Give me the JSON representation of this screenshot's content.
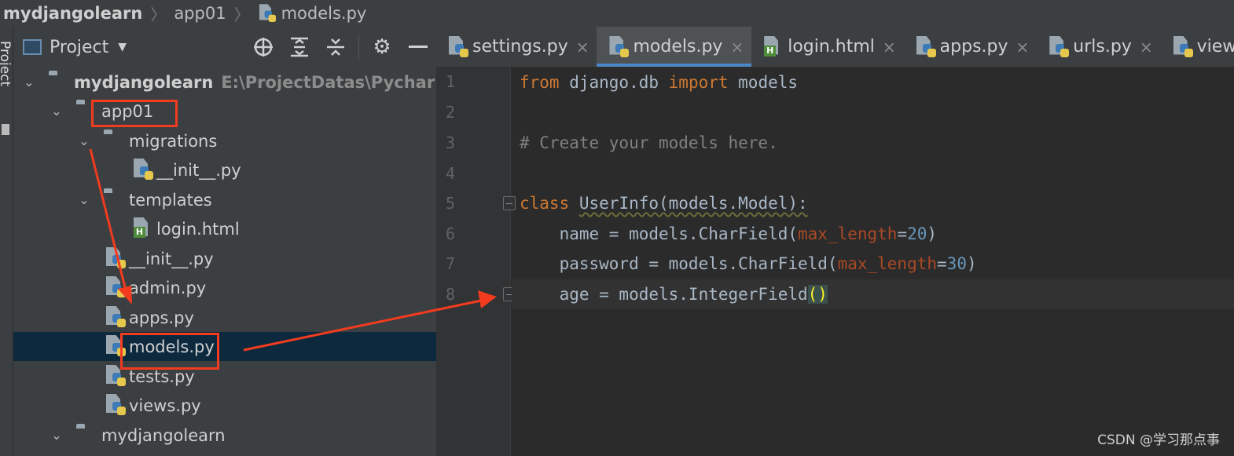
{
  "breadcrumb": {
    "project": "mydjangolearn",
    "folder": "app01",
    "file": "models.py"
  },
  "side_strip": {
    "label": "Project"
  },
  "project_panel": {
    "title": "Project",
    "icons": [
      "crosshair-icon",
      "expand-all-icon",
      "collapse-all-icon",
      "gear-icon",
      "minimize-icon"
    ],
    "root": {
      "name": "mydjangolearn",
      "path": "E:\\ProjectDatas\\PycharmPro"
    },
    "items": [
      {
        "label": "app01"
      },
      {
        "label": "migrations"
      },
      {
        "label": "__init__.py"
      },
      {
        "label": "templates"
      },
      {
        "label": "login.html"
      },
      {
        "label": "__init__.py"
      },
      {
        "label": "admin.py"
      },
      {
        "label": "apps.py"
      },
      {
        "label": "models.py"
      },
      {
        "label": "tests.py"
      },
      {
        "label": "views.py"
      },
      {
        "label": "mydjangolearn"
      }
    ],
    "selected": "models.py"
  },
  "tabs": [
    {
      "label": "settings.py",
      "close": "×"
    },
    {
      "label": "models.py",
      "close": "×",
      "active": true
    },
    {
      "label": "login.html",
      "close": "×"
    },
    {
      "label": "apps.py",
      "close": "×"
    },
    {
      "label": "urls.py",
      "close": "×"
    },
    {
      "label": "views.py",
      "close": ""
    }
  ],
  "editor": {
    "line_numbers": [
      "1",
      "2",
      "3",
      "4",
      "5",
      "6",
      "7",
      "8"
    ],
    "code": {
      "l1": {
        "kw1": "from",
        "t1": " django.db ",
        "kw2": "import",
        "t2": " models"
      },
      "l3": {
        "comment": "# Create your models here."
      },
      "l5": {
        "kw": "class",
        "t1": " ",
        "cls": "UserInfo(models.Model):"
      },
      "l6": {
        "t1": "    name = models.CharField(",
        "param": "max_length",
        "eq": "=",
        "num": "20",
        "t2": ")"
      },
      "l7": {
        "t1": "    password = models.CharField(",
        "param": "max_length",
        "eq": "=",
        "num": "30",
        "t2": ")"
      },
      "l8": {
        "t1": "    age = models.IntegerField",
        "paren": "()"
      }
    },
    "current_line": 8
  },
  "watermark": "CSDN @学习那点事",
  "colors": {
    "annotation": "#f23b1f",
    "selection": "#0d293e",
    "accent": "#4a88c7"
  }
}
